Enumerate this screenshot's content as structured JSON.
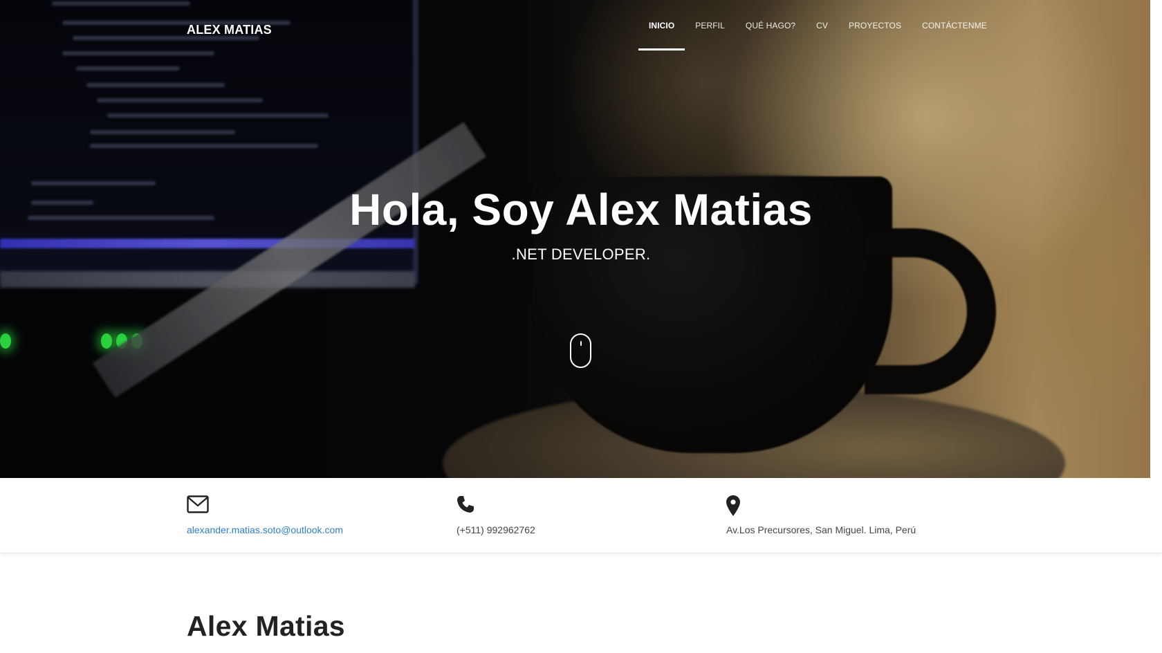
{
  "header": {
    "brand": "ALEX MATIAS",
    "nav": [
      {
        "label": "INICIO",
        "active": true
      },
      {
        "label": "PERFIL"
      },
      {
        "label": "QUÉ HAGO?"
      },
      {
        "label": "CV"
      },
      {
        "label": "PROYECTOS"
      },
      {
        "label": "CONTÁCTENME"
      }
    ]
  },
  "hero": {
    "title": "Hola, Soy Alex Matias",
    "subtitle": ".NET DEVELOPER.",
    "scroll_icon": "mouse-scroll-icon"
  },
  "contact": {
    "email": {
      "icon": "envelope-icon",
      "text": "alexander.matias.soto@outlook.com"
    },
    "phone": {
      "icon": "phone-icon",
      "text": "(+511) 992962762"
    },
    "address": {
      "icon": "map-marker-icon",
      "text": "Av.Los Precursores, San Miguel. Lima, Perú"
    }
  },
  "profile": {
    "name": "Alex Matias"
  },
  "colors": {
    "link": "#2f7fcc",
    "heading": "#222222",
    "text": "#444444",
    "nav_text": "#ffffff"
  }
}
